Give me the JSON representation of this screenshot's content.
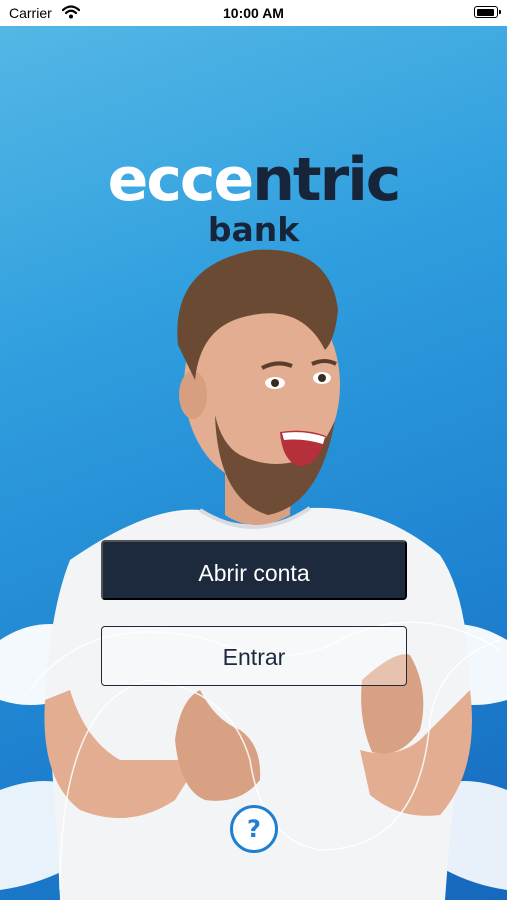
{
  "status_bar": {
    "carrier": "Carrier",
    "time": "10:00 AM",
    "battery_level": 0.9
  },
  "logo": {
    "word_light": "ecce",
    "word_dark": "ntric",
    "subtitle": "bank"
  },
  "actions": {
    "open_account": "Abrir conta",
    "sign_in": "Entrar"
  },
  "help": {
    "icon": "question-mark-icon",
    "glyph": "?"
  },
  "colors": {
    "background_top": "#57b9e6",
    "background_bottom": "#1668bd",
    "brand_dark": "#17253a",
    "help_blue": "#1f7fd0"
  }
}
